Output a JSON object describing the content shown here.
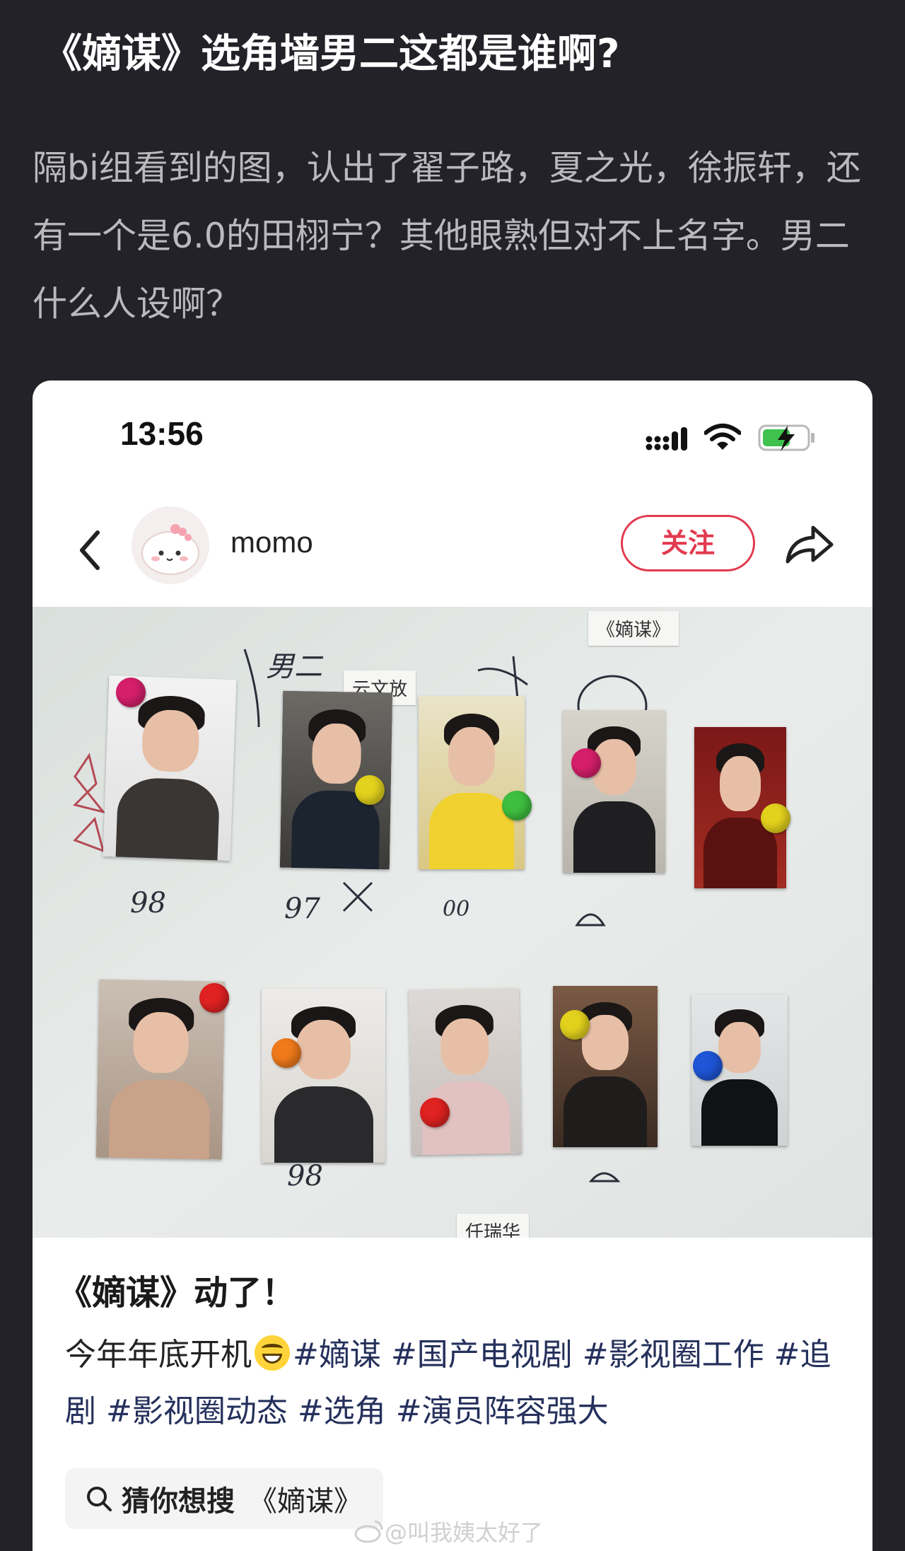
{
  "post": {
    "title": "《嫡谋》选角墙男二这都是谁啊?",
    "body": "隔bi组看到的图，认出了翟子路，夏之光，徐振轩，还有一个是6.0的田栩宁？其他眼熟但对不上名字。男二什么人设啊？"
  },
  "screenshot": {
    "status_bar": {
      "time": "13:56"
    },
    "profile": {
      "username": "momo",
      "follow_label": "关注"
    },
    "photo": {
      "paper_tags": [
        "《嫡谋》",
        "云文放",
        "任瑞华"
      ],
      "handwriting": [
        "男二",
        "98",
        "97",
        "00",
        "98"
      ]
    },
    "caption": {
      "title": "《嫡谋》动了！",
      "lead": "今年年底开机",
      "hashtags": [
        "#嫡谋",
        "#国产电视剧",
        "#影视圈工作",
        "#追剧",
        "#影视圈动态",
        "#选角",
        "#演员阵容强大"
      ]
    },
    "search_chip": {
      "prefix": "猜你想搜",
      "keyword": "《嫡谋》"
    }
  },
  "watermark": "@叫我姨太好了",
  "colors": {
    "background": "#232228",
    "accent": "#e23a4f",
    "hashtag": "#25305c"
  }
}
